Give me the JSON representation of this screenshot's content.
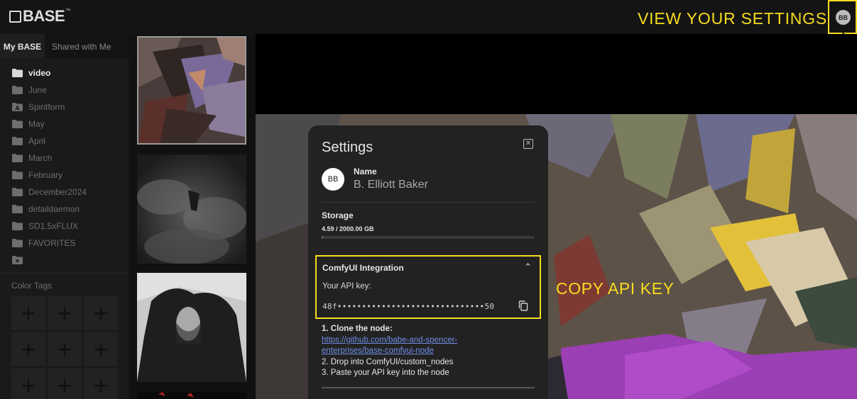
{
  "header": {
    "logo": "BASE",
    "logo_tm": "™",
    "annotation_settings": "VIEW YOUR SETTINGS",
    "avatar_initials": "BB"
  },
  "sidebar": {
    "tabs": [
      "My BASE",
      "Shared with Me"
    ],
    "folders": [
      "video",
      "June",
      "Spiritform",
      "May",
      "April",
      "March",
      "February",
      "December2024",
      "detaildaemon",
      "SD1.5xFLUX",
      "FAVORITES"
    ],
    "color_tags_title": "Color Tags",
    "color_tag_plus": "+"
  },
  "annotation_api": "COPY API KEY",
  "settings": {
    "title": "Settings",
    "close": "✕",
    "avatar_initials": "BB",
    "name_label": "Name",
    "name_value": "B. Elliott Baker",
    "storage_label": "Storage",
    "storage_value": "4.59 / 2000.00 GB",
    "storage_fraction": 0.0023,
    "comfy_title": "ComfyUI Integration",
    "comfy_chevron": "⌃",
    "api_label": "Your API key:",
    "api_key": "48f••••••••••••••••••••••••••••••50",
    "step1": "1. Clone the node:",
    "step1_link": "https://github.com/babe-and-spencer-enterprises/base-comfyui-node",
    "step2": "2. Drop into ComfyUI/custom_nodes",
    "step3": "3. Paste your API key into the node"
  },
  "colors": {
    "accent_yellow": "#f7dc1f",
    "link_blue": "#6f8fe6"
  }
}
